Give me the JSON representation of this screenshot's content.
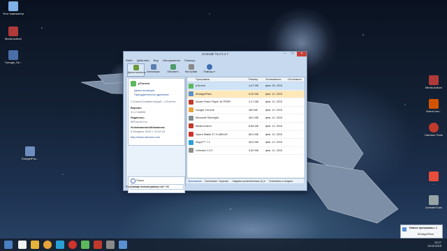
{
  "desktop": {
    "left_icons": [
      {
        "label": "Этот компьютер",
        "icon": "computer-icon"
      },
      {
        "label": "Media Action!",
        "icon": "media-action-icon"
      },
      {
        "label": "Tunngle_Se...",
        "icon": "tunngle-icon"
      },
      {
        "label": "IGadgetPac...",
        "icon": "gadgetpack-icon"
      }
    ],
    "right_icons": [
      {
        "label": "Media Action!",
        "icon": "media-action-icon"
      },
      {
        "label": "VideoConv...",
        "icon": "video-converter-icon"
      },
      {
        "label": "Daemon Tools",
        "icon": "daemon-tools-icon"
      },
      {
        "label": "...",
        "icon": "recycle-icon"
      },
      {
        "label": "AnimateTools",
        "icon": "app-icon"
      }
    ]
  },
  "window": {
    "title": "Uninstall Tool 3.4.7",
    "menu": [
      "Файл",
      "Действия",
      "Вид",
      "Инструменты",
      "Помощь"
    ],
    "toolbar": [
      {
        "label": "Деинсталлятор",
        "icon": "uninstaller-icon"
      },
      {
        "label": "Автозапуск",
        "icon": "autostart-icon"
      },
      {
        "label": "Обновить",
        "icon": "refresh-icon"
      },
      {
        "label": "Настройки",
        "icon": "settings-icon"
      },
      {
        "label": "Помощь ▾",
        "icon": "help-icon"
      }
    ],
    "details": {
      "app_name": "µTorrent",
      "action_uninstall": "Деинсталляция",
      "action_force": "Принудительное удаление",
      "path": "C:\\Users\\Caballero\\AppD...\\uTorrent",
      "version_label": "Версия:",
      "version": "3.4.2.38836",
      "publisher_label": "Издатель:",
      "publisher": "BitTorrent Inc.",
      "installed_label": "Установлено/обновлено:",
      "installed": "9 Февраль 2015 г. 11:43:15",
      "website": "http://www.utorrent.com"
    },
    "search": {
      "title": "Поиск",
      "placeholder": "Введите слово для поиска"
    },
    "columns": [
      "Программа",
      "Размер",
      "Установлено",
      "Отслежено"
    ],
    "programs": [
      {
        "name": "µTorrent",
        "size": "4,07 МБ",
        "date": "фев. 09, 2015",
        "color": "#5cb85c"
      },
      {
        "name": "8GadgetPack",
        "size": "6,49 МБ",
        "date": "фев. 12, 2015",
        "color": "#5a8fd0"
      },
      {
        "name": "Adobe Flash Player 16 PPAPI",
        "size": "4,17 МБ",
        "date": "фев. 12, 2015",
        "color": "#c0392b"
      },
      {
        "name": "Google Chrome",
        "size": "360 МБ",
        "date": "фев. 12, 2015",
        "color": "#e8a33a"
      },
      {
        "name": "Microsoft Silverlight",
        "size": "48,0 МБ",
        "date": "фев. 12, 2015",
        "color": "#7f8c8d"
      },
      {
        "name": "Media Action!",
        "size": "8,68 МБ",
        "date": "фев. 12, 2015",
        "color": "#c0392b"
      },
      {
        "name": "Opera Stable 27.0.1689.69",
        "size": "68,3 МБ",
        "date": "фев. 12, 2015",
        "color": "#d0342c"
      },
      {
        "name": "Skype™ 7.1",
        "size": "46,5 МБ",
        "date": "фев. 12, 2015",
        "color": "#2a9fd6"
      },
      {
        "name": "Unlocker 1.9.2",
        "size": "3,50 МБ",
        "date": "фев. 12, 2015",
        "color": "#8e8e8e"
      }
    ],
    "filters": [
      "Приложения",
      "Системные",
      "Скрытые",
      "Недавно установленные (1) ▾",
      "Установить и следить"
    ],
    "status": "9 программ, полный размер - 417 МБ"
  },
  "notification": {
    "title": "Новые программы: 1",
    "item": "8GadgetPack"
  },
  "taskbar": {
    "time": "12:17",
    "date": "13.02.2015"
  }
}
